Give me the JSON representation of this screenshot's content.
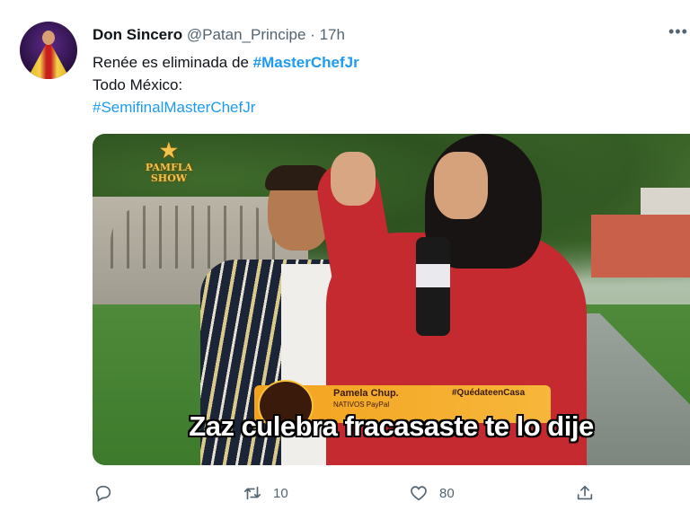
{
  "author": {
    "name": "Don Sincero",
    "handle": "@Patan_Principe",
    "separator": "·",
    "time": "17h"
  },
  "more_icon": "more-horizontal-icon",
  "tweet": {
    "line1_prefix": "Renée es eliminada de ",
    "line1_hashtag": "#MasterChefJr",
    "line2": "Todo México:",
    "line3_hashtag": "#SemifinalMasterChefJr"
  },
  "media": {
    "logo_text": "PAMFLA SHOW",
    "lower_third_name": "Pamela Chup.",
    "lower_third_sub": "NATIVOS PayPal",
    "lower_third_tag": "#QuédateenCasa",
    "caption": "Zaz culebra fracasaste te lo dije"
  },
  "actions": {
    "reply_icon": "reply-icon",
    "retweet_icon": "retweet-icon",
    "retweet_count": "10",
    "like_icon": "heart-icon",
    "like_count": "80",
    "share_icon": "share-icon"
  },
  "colors": {
    "link": "#1d9bf0",
    "secondary_text": "#536471",
    "primary_text": "#0f1419"
  }
}
